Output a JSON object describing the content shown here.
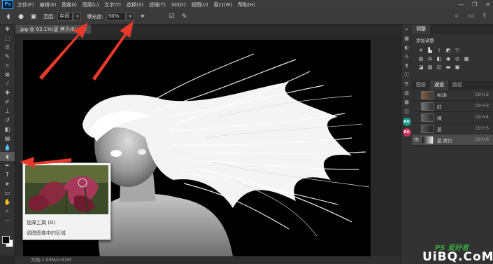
{
  "menubar": {
    "logo": "Ps",
    "items": [
      "文件(F)",
      "编辑(E)",
      "图像(I)",
      "图层(L)",
      "文字(Y)",
      "选择(S)",
      "滤镜(T)",
      "3D(D)",
      "视图(V)",
      "窗口(W)",
      "帮助(H)"
    ],
    "window_controls": [
      "—",
      "❐",
      "✕"
    ]
  },
  "options_bar": {
    "range_label": "范围:",
    "range_value": "中间",
    "exposure_label": "曝光度:",
    "exposure_value": "50%"
  },
  "document": {
    "tab_title": ".jpg @ 93.1%(蓝 拷贝/8) *",
    "close_icon": "×"
  },
  "tooltip": {
    "title": "加深工具 (O)",
    "description": "调暗图像中的区域"
  },
  "status_bar": {
    "text": "文档:1.04M/2.61M"
  },
  "side_strip": {
    "badge_1": "RA",
    "badge_2": "RA"
  },
  "adjustments_panel": {
    "tab": "调整",
    "title": "添加调整"
  },
  "channels_panel": {
    "tabs": [
      "图层",
      "通道",
      "路径"
    ],
    "active_tab": "通道",
    "channels": [
      {
        "name": "RGB",
        "shortcut": "Ctrl+2"
      },
      {
        "name": "红",
        "shortcut": "Ctrl+3"
      },
      {
        "name": "绿",
        "shortcut": "Ctrl+4"
      },
      {
        "name": "蓝",
        "shortcut": "Ctrl+5"
      },
      {
        "name": "蓝 拷贝",
        "shortcut": "Ctrl+6"
      }
    ]
  },
  "watermark": {
    "top": "PS 爱好者",
    "bottom": "UiBQ.CoM"
  },
  "colors": {
    "arrow": "#e8392b",
    "ui_dark": "#323232",
    "canvas_bg": "#000000"
  }
}
